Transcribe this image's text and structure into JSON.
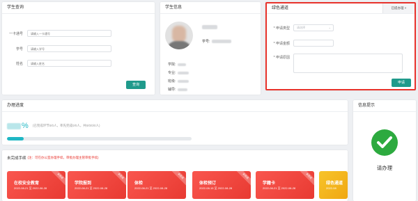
{
  "student_query": {
    "title": "学生查询",
    "card_label": "一卡通号",
    "card_placeholder": "请输入一卡通号",
    "sid_label": "学号",
    "sid_placeholder": "请输入学号",
    "name_label": "姓名",
    "name_placeholder": "请输入姓名",
    "query_button": "查询"
  },
  "student_info": {
    "title": "学生信息",
    "student_no_label": "学号:",
    "college_label": "学院:",
    "major_label": "专业:",
    "class_label": "班级:",
    "counselor_label": "辅导:"
  },
  "green_channel": {
    "title": "绿色通道",
    "handled_button": "已提办理 ×",
    "type_label": "* 申请类型",
    "type_placeholder": "请选择",
    "amount_label": "* 申请金额",
    "reason_label": "* 申请原因",
    "submit_button": "申请"
  },
  "progress": {
    "title": "办理进度",
    "percent_suffix": "%",
    "stats": "(已完成环节0/0人，率先完成0/0人，共0/0/0/0人)",
    "value": 0.09,
    "colors": {
      "fill": "#1fb7c4",
      "track": "#e6e9ec"
    }
  },
  "tasks": {
    "title": "未完成手续",
    "note": "(注：可在办公室办理手续，审批办理主管审批手续)",
    "items": [
      {
        "name": "在校安全教育",
        "date": "2022-08-21 至 2022-08-28",
        "badge": "未完成"
      },
      {
        "name": "学院报到",
        "date": "2022-08-21 至 2022-08-28",
        "badge": "未完成"
      },
      {
        "name": "体检",
        "date": "2022-08-21 至 2022-08-28",
        "badge": "未完成"
      },
      {
        "name": "体检预订",
        "date": "2022-08-15 至 2022-08-28",
        "badge": "未完成"
      },
      {
        "name": "学籍卡",
        "date": "2022-08-21 至 2022-08-28",
        "badge": "未完成"
      },
      {
        "name": "绿色通道",
        "date": "2022-08",
        "badge": ""
      }
    ]
  },
  "info_tip": {
    "title": "信息提示",
    "message": "请办理",
    "colors": {
      "check": "#2daa3f"
    }
  }
}
